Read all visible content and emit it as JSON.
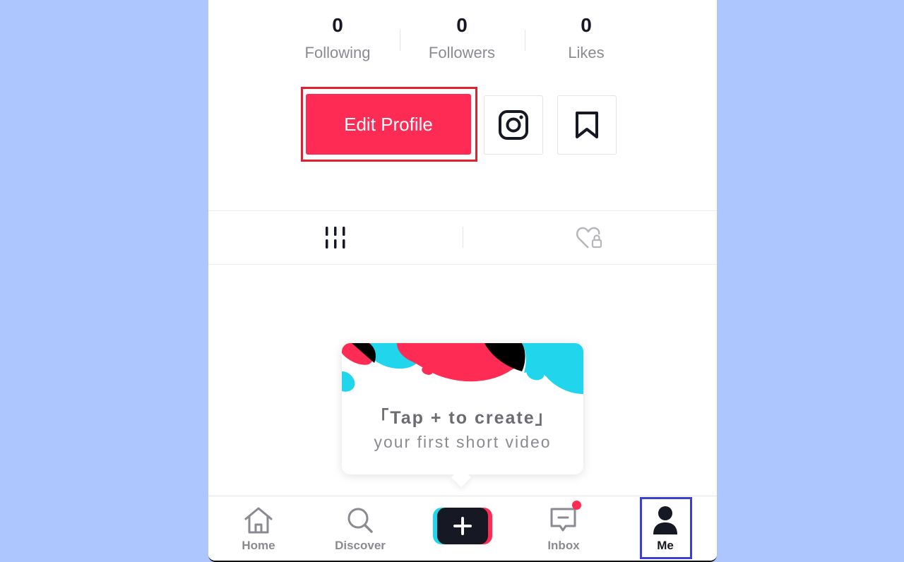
{
  "stats": [
    {
      "value": "0",
      "label": "Following"
    },
    {
      "value": "0",
      "label": "Followers"
    },
    {
      "value": "0",
      "label": "Likes"
    }
  ],
  "actions": {
    "edit_profile_label": "Edit Profile",
    "instagram_icon": "instagram-icon",
    "bookmark_icon": "bookmark-icon"
  },
  "tabs": [
    {
      "icon": "grid-icon",
      "active": true
    },
    {
      "icon": "heart-lock-icon",
      "active": false
    }
  ],
  "create_popup": {
    "title": "「Tap + to create」",
    "subtitle": "your first short video"
  },
  "bottom_nav": [
    {
      "label": "Home",
      "icon": "home-icon"
    },
    {
      "label": "Discover",
      "icon": "search-icon"
    },
    {
      "label": "",
      "icon": "plus-icon"
    },
    {
      "label": "Inbox",
      "icon": "inbox-icon",
      "badge": true
    },
    {
      "label": "Me",
      "icon": "person-icon",
      "active": true
    }
  ],
  "colors": {
    "accent": "#fe2c55",
    "cyan": "#20d5ec",
    "dark": "#161823",
    "background": "#adc6fe",
    "highlight_red": "#e0202e",
    "highlight_blue": "#3b3fd6"
  }
}
